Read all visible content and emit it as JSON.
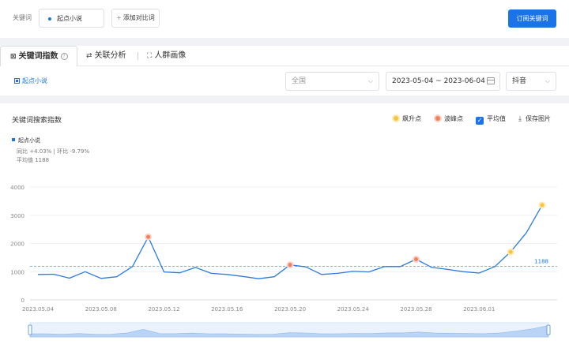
{
  "header": {
    "keyword_label": "关键词",
    "keyword_chip": "起点小说",
    "add_compare": "添加对比词",
    "subscribe": "订阅关键词"
  },
  "tabs": [
    {
      "label": "关键词指数",
      "icon": "chart-icon",
      "active": true
    },
    {
      "label": "关联分析",
      "icon": "link-arrows-icon",
      "active": false
    },
    {
      "label": "人群画像",
      "icon": "person-scan-icon",
      "active": false
    }
  ],
  "filters": {
    "legend_keyword": "起点小说",
    "region": "全国",
    "date_range": "2023-05-04 ~ 2023-06-04",
    "platform": "抖音"
  },
  "panel": {
    "title": "关键词搜索指数",
    "options": {
      "rise": "飙升点",
      "peak": "波峰点",
      "average": "平均值",
      "save": "保存图片"
    },
    "series_name": "起点小说",
    "yoy_line": "同比 +4.03% | 环比 -9.79%",
    "avg_line": "平均值 1188"
  },
  "colors": {
    "accent": "#1a73e8",
    "line": "#2b7be0",
    "rise_point": "#f5c542",
    "peak_point": "#f08060"
  },
  "chart_data": {
    "type": "line",
    "x": [
      "2023.05.04",
      "2023.05.05",
      "2023.05.06",
      "2023.05.07",
      "2023.05.08",
      "2023.05.09",
      "2023.05.10",
      "2023.05.11",
      "2023.05.12",
      "2023.05.13",
      "2023.05.14",
      "2023.05.15",
      "2023.05.16",
      "2023.05.17",
      "2023.05.18",
      "2023.05.19",
      "2023.05.20",
      "2023.05.21",
      "2023.05.22",
      "2023.05.23",
      "2023.05.24",
      "2023.05.25",
      "2023.05.26",
      "2023.05.27",
      "2023.05.28",
      "2023.05.29",
      "2023.05.30",
      "2023.05.31",
      "2023.06.01",
      "2023.06.02",
      "2023.06.03",
      "2023.06.04"
    ],
    "x_tick_labels": [
      "2023.05.04",
      "2023.05.08",
      "2023.05.12",
      "2023.05.16",
      "2023.05.20",
      "2023.05.24",
      "2023.05.28",
      "2023.06.01"
    ],
    "series": [
      {
        "name": "起点小说",
        "values": [
          900,
          910,
          770,
          1000,
          760,
          820,
          1180,
          2230,
          990,
          960,
          1150,
          940,
          900,
          830,
          750,
          820,
          1240,
          1170,
          900,
          940,
          1010,
          990,
          1180,
          1180,
          1440,
          1150,
          1080,
          1000,
          950,
          1180,
          1700,
          2380,
          3360
        ]
      }
    ],
    "yticks": [
      0,
      1000,
      2000,
      3000,
      4000
    ],
    "ylim": [
      0,
      4000
    ],
    "average": 1188,
    "average_label": "1188",
    "peak_points": [
      {
        "x": "2023.05.11",
        "y": 2230
      },
      {
        "x": "2023.05.20",
        "y": 1240
      },
      {
        "x": "2023.05.28",
        "y": 1440
      }
    ],
    "rise_points": [
      {
        "x": "2023.06.02",
        "y": 1700
      },
      {
        "x": "2023.06.04",
        "y": 3360
      }
    ],
    "grid": true
  }
}
